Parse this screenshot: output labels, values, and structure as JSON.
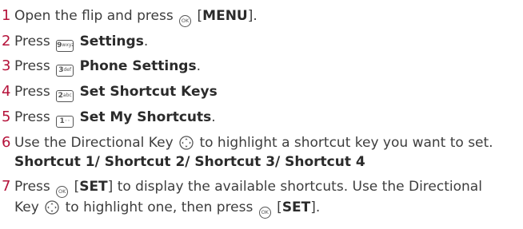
{
  "steps": [
    {
      "num": "1",
      "pre": "Open the flip and press",
      "ok_key": "OK",
      "mid": "[",
      "bold": "MENU",
      "post": "]."
    },
    {
      "num": "2",
      "pre": "Press",
      "key_digit": "9",
      "key_sub": "wxyz",
      "bold": "Settings",
      "post": "."
    },
    {
      "num": "3",
      "pre": "Press",
      "key_digit": "3",
      "key_sub": "def",
      "bold": "Phone Settings",
      "post": "."
    },
    {
      "num": "4",
      "pre": "Press",
      "key_digit": "2",
      "key_sub": "abc",
      "bold": "Set Shortcut Keys",
      "post": ""
    },
    {
      "num": "5",
      "pre": "Press",
      "key_digit": "1",
      "key_sub": "",
      "bold": "Set My Shortcuts",
      "post": "."
    },
    {
      "num": "6",
      "pre": "Use the Directional Key",
      "post": "to highlight a shortcut key you want to set.",
      "line2_bold": "Shortcut 1/ Shortcut 2/ Shortcut 3/ Shortcut 4"
    },
    {
      "num": "7",
      "pre": "Press",
      "ok_key": "OK",
      "mid": "[",
      "bold": "SET",
      "post": "] to display the available shortcuts. Use the Directional",
      "line2_pre": "Key",
      "line2_mid": "to highlight one, then press",
      "line2_ok": "OK",
      "line2_open": "[",
      "line2_bold": "SET",
      "line2_post": "]."
    }
  ]
}
